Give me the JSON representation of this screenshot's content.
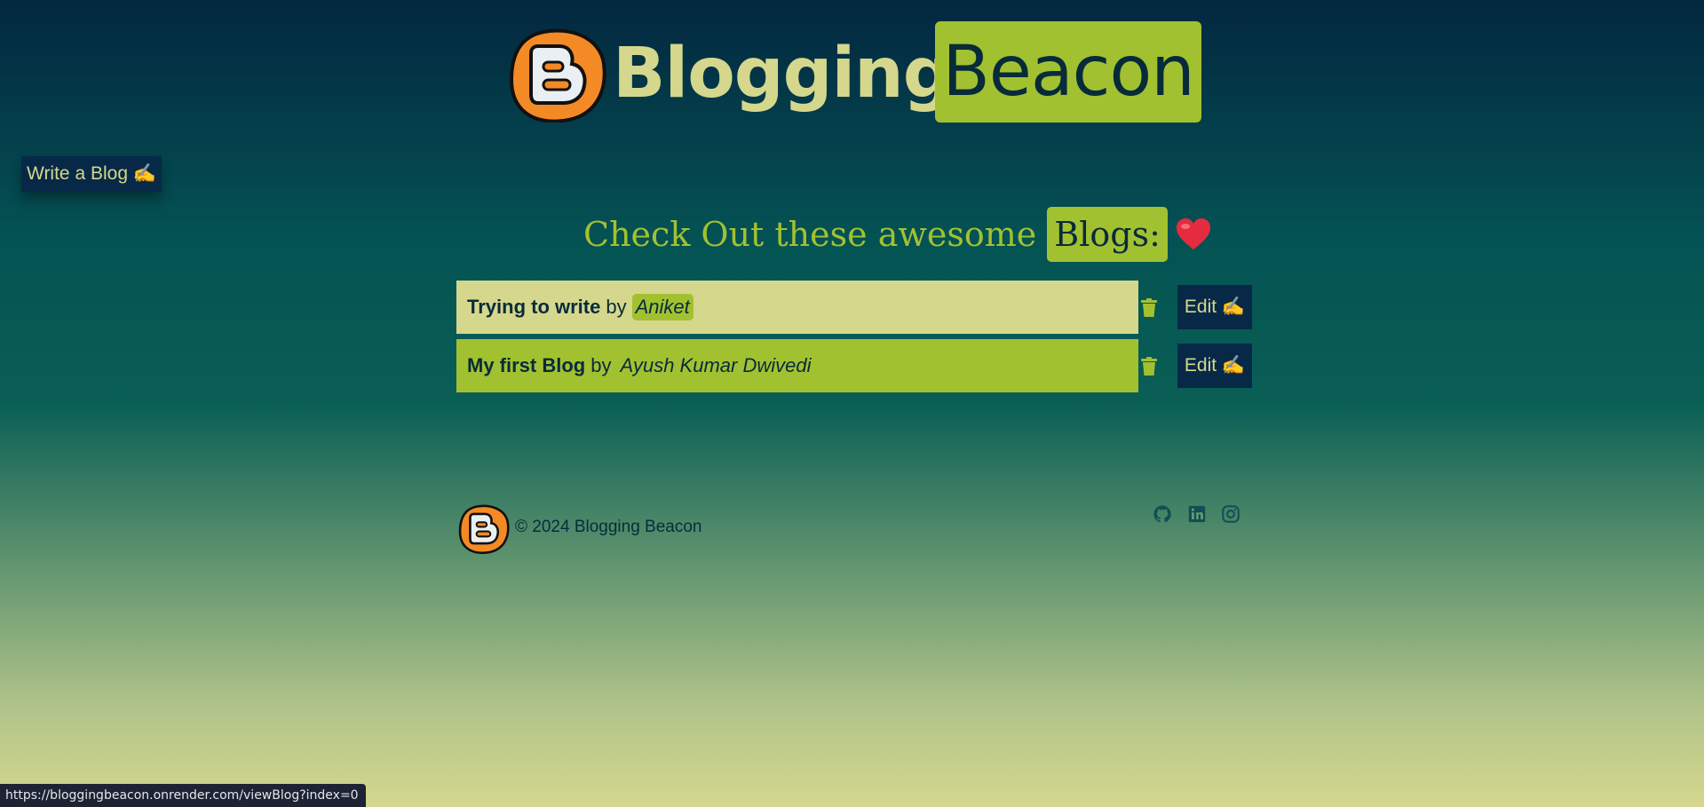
{
  "header": {
    "brand_part1": "Blogging",
    "brand_part2": "Beacon"
  },
  "nav": {
    "write_label": "Write a Blog ✍️"
  },
  "headline": {
    "text": "Check Out these awesome",
    "chip": "Blogs:"
  },
  "blogs": [
    {
      "title": "Trying to write",
      "by": "by",
      "author": "Aniket",
      "edit_label": "Edit ✍️"
    },
    {
      "title": "My first Blog",
      "by": "by",
      "author": "Ayush Kumar Dwivedi",
      "edit_label": "Edit ✍️"
    }
  ],
  "footer": {
    "copyright": "© 2024 Blogging Beacon",
    "social": [
      "github-icon",
      "linkedin-icon",
      "instagram-icon"
    ]
  },
  "status": {
    "url": "https://bloggingbeacon.onrender.com/viewBlog?index=0"
  },
  "colors": {
    "accent": "#a2c131",
    "cream": "#d5d78c",
    "navy": "#072947",
    "logo_orange": "#f48a25"
  }
}
